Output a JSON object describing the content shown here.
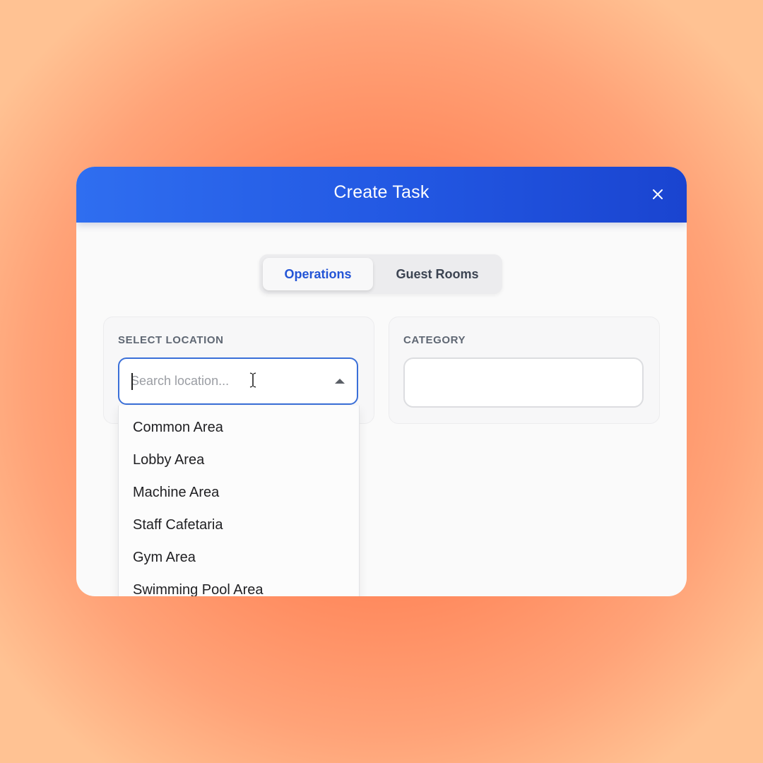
{
  "modal": {
    "title": "Create Task"
  },
  "tabs": [
    {
      "label": "Operations",
      "active": true
    },
    {
      "label": "Guest Rooms",
      "active": false
    }
  ],
  "location": {
    "label": "SELECT LOCATION",
    "placeholder": "Search location...",
    "value": "",
    "options": [
      "Common Area",
      "Lobby Area",
      "Machine Area",
      "Staff Cafetaria",
      "Gym Area",
      "Swimming Pool Area"
    ]
  },
  "category": {
    "label": "CATEGORY",
    "value": ""
  },
  "colors": {
    "header_blue": "#2257e2",
    "accent_blue": "#2355d6",
    "background_orange": "#ff7a50"
  },
  "icons": {
    "close": "close-icon",
    "dropdown_open": "chevron-up-icon",
    "dropdown_closed": "chevron-down-icon"
  }
}
